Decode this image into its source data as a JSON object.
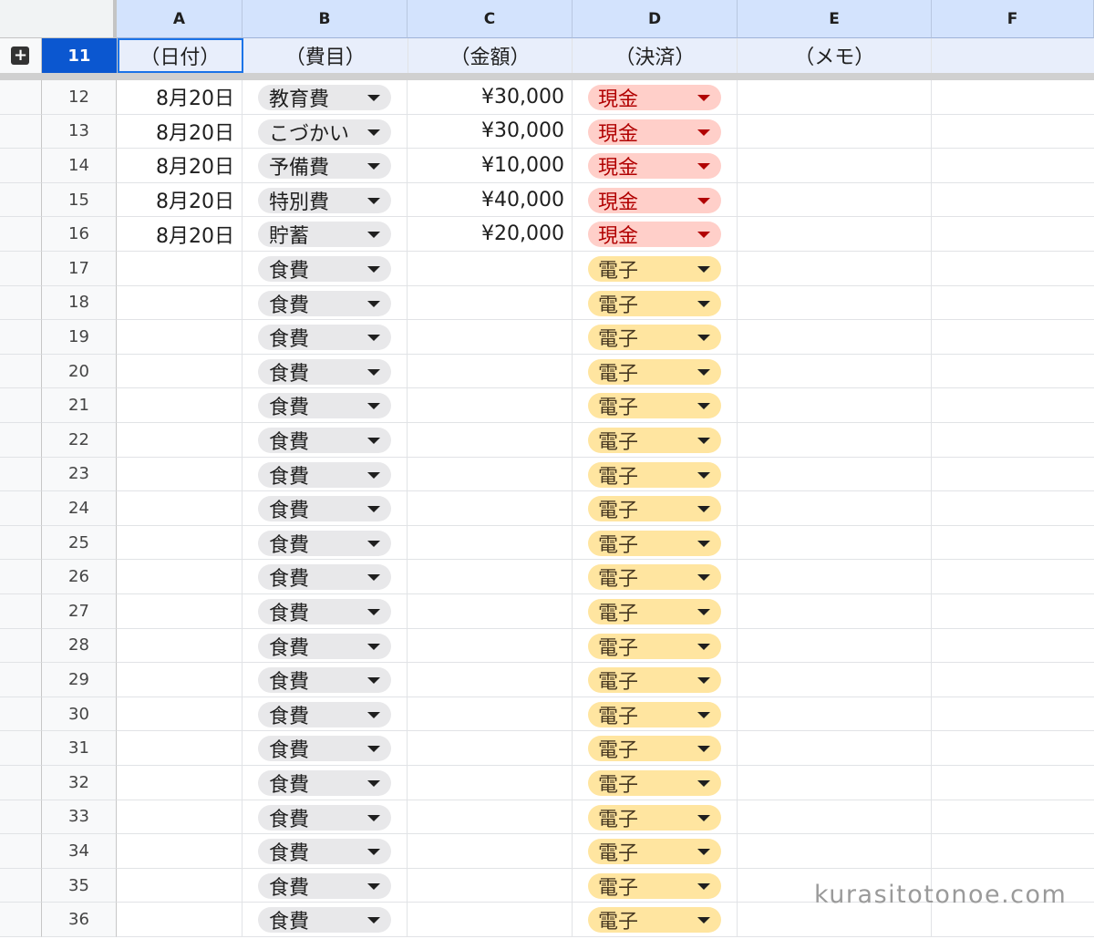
{
  "columns": [
    "A",
    "B",
    "C",
    "D",
    "E",
    "F"
  ],
  "header_row": {
    "number": "11",
    "cells": [
      "（日付）",
      "（費目）",
      "（金額）",
      "（決済）",
      "（メモ）",
      ""
    ]
  },
  "rows": [
    {
      "num": "12",
      "date": "8月20日",
      "category": "教育費",
      "amount": "¥30,000",
      "payment": "現金"
    },
    {
      "num": "13",
      "date": "8月20日",
      "category": "こづかい",
      "amount": "¥30,000",
      "payment": "現金"
    },
    {
      "num": "14",
      "date": "8月20日",
      "category": "予備費",
      "amount": "¥10,000",
      "payment": "現金"
    },
    {
      "num": "15",
      "date": "8月20日",
      "category": "特別費",
      "amount": "¥40,000",
      "payment": "現金"
    },
    {
      "num": "16",
      "date": "8月20日",
      "category": "貯蓄",
      "amount": "¥20,000",
      "payment": "現金"
    },
    {
      "num": "17",
      "date": "",
      "category": "食費",
      "amount": "",
      "payment": "電子"
    },
    {
      "num": "18",
      "date": "",
      "category": "食費",
      "amount": "",
      "payment": "電子"
    },
    {
      "num": "19",
      "date": "",
      "category": "食費",
      "amount": "",
      "payment": "電子"
    },
    {
      "num": "20",
      "date": "",
      "category": "食費",
      "amount": "",
      "payment": "電子"
    },
    {
      "num": "21",
      "date": "",
      "category": "食費",
      "amount": "",
      "payment": "電子"
    },
    {
      "num": "22",
      "date": "",
      "category": "食費",
      "amount": "",
      "payment": "電子"
    },
    {
      "num": "23",
      "date": "",
      "category": "食費",
      "amount": "",
      "payment": "電子"
    },
    {
      "num": "24",
      "date": "",
      "category": "食費",
      "amount": "",
      "payment": "電子"
    },
    {
      "num": "25",
      "date": "",
      "category": "食費",
      "amount": "",
      "payment": "電子"
    },
    {
      "num": "26",
      "date": "",
      "category": "食費",
      "amount": "",
      "payment": "電子"
    },
    {
      "num": "27",
      "date": "",
      "category": "食費",
      "amount": "",
      "payment": "電子"
    },
    {
      "num": "28",
      "date": "",
      "category": "食費",
      "amount": "",
      "payment": "電子"
    },
    {
      "num": "29",
      "date": "",
      "category": "食費",
      "amount": "",
      "payment": "電子"
    },
    {
      "num": "30",
      "date": "",
      "category": "食費",
      "amount": "",
      "payment": "電子"
    },
    {
      "num": "31",
      "date": "",
      "category": "食費",
      "amount": "",
      "payment": "電子"
    },
    {
      "num": "32",
      "date": "",
      "category": "食費",
      "amount": "",
      "payment": "電子"
    },
    {
      "num": "33",
      "date": "",
      "category": "食費",
      "amount": "",
      "payment": "電子"
    },
    {
      "num": "34",
      "date": "",
      "category": "食費",
      "amount": "",
      "payment": "電子"
    },
    {
      "num": "35",
      "date": "",
      "category": "食費",
      "amount": "",
      "payment": "電子"
    },
    {
      "num": "36",
      "date": "",
      "category": "食費",
      "amount": "",
      "payment": "電子"
    }
  ],
  "chip_colors": {
    "cash_bg": "#ffcfc9",
    "cash_text": "#b10202",
    "elec_bg": "#ffe5a0",
    "category_bg": "#e8e8ea"
  },
  "icons": {
    "expand": "plus-icon",
    "dropdown": "triangle-down-icon"
  },
  "watermark": "kurasitotonoe.com"
}
